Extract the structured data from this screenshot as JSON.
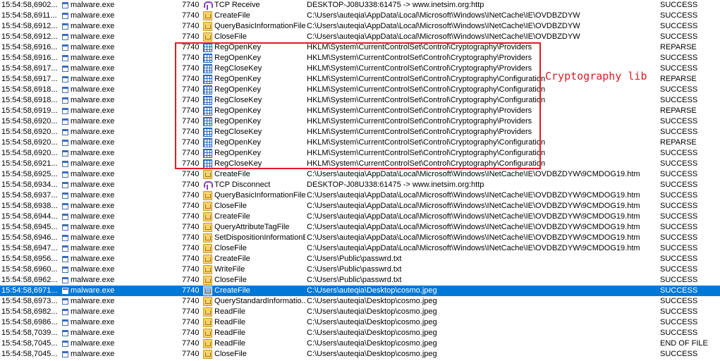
{
  "annotation": {
    "label": "Cryptography lib",
    "color": "#e01c24"
  },
  "colors": {
    "selection": "#0078d7",
    "background": "#ffffff"
  },
  "rows": [
    {
      "time": "15:54:58,6902...",
      "process": "malware.exe",
      "pid": "7740",
      "operation": "TCP Receive",
      "op_icon": "network-icon",
      "path": "DESKTOP-J08U338:61475 -> www.inetsim.org:http",
      "result": "SUCCESS"
    },
    {
      "time": "15:54:58,6911...",
      "process": "malware.exe",
      "pid": "7740",
      "operation": "CreateFile",
      "op_icon": "file-icon",
      "path": "C:\\Users\\auteqia\\AppData\\Local\\Microsoft\\Windows\\INetCache\\IE\\OVDBZDYW",
      "result": "SUCCESS"
    },
    {
      "time": "15:54:58,6912...",
      "process": "malware.exe",
      "pid": "7740",
      "operation": "QueryBasicInformationFile",
      "op_icon": "file-icon",
      "path": "C:\\Users\\auteqia\\AppData\\Local\\Microsoft\\Windows\\INetCache\\IE\\OVDBZDYW",
      "result": "SUCCESS"
    },
    {
      "time": "15:54:58,6912...",
      "process": "malware.exe",
      "pid": "7740",
      "operation": "CloseFile",
      "op_icon": "file-icon",
      "path": "C:\\Users\\auteqia\\AppData\\Local\\Microsoft\\Windows\\INetCache\\IE\\OVDBZDYW",
      "result": "SUCCESS"
    },
    {
      "time": "15:54:58,6916...",
      "process": "malware.exe",
      "pid": "7740",
      "operation": "RegOpenKey",
      "op_icon": "registry-icon",
      "path": "HKLM\\System\\CurrentControlSet\\Control\\Cryptography\\Providers",
      "result": "REPARSE"
    },
    {
      "time": "15:54:58,6916...",
      "process": "malware.exe",
      "pid": "7740",
      "operation": "RegOpenKey",
      "op_icon": "registry-icon",
      "path": "HKLM\\System\\CurrentControlSet\\Control\\Cryptography\\Providers",
      "result": "SUCCESS"
    },
    {
      "time": "15:54:58,6917...",
      "process": "malware.exe",
      "pid": "7740",
      "operation": "RegCloseKey",
      "op_icon": "registry-icon",
      "path": "HKLM\\System\\CurrentControlSet\\Control\\Cryptography\\Providers",
      "result": "SUCCESS"
    },
    {
      "time": "15:54:58,6917...",
      "process": "malware.exe",
      "pid": "7740",
      "operation": "RegOpenKey",
      "op_icon": "registry-icon",
      "path": "HKLM\\System\\CurrentControlSet\\Control\\Cryptography\\Configuration",
      "result": "REPARSE"
    },
    {
      "time": "15:54:58,6918...",
      "process": "malware.exe",
      "pid": "7740",
      "operation": "RegOpenKey",
      "op_icon": "registry-icon",
      "path": "HKLM\\System\\CurrentControlSet\\Control\\Cryptography\\Configuration",
      "result": "SUCCESS"
    },
    {
      "time": "15:54:58,6918...",
      "process": "malware.exe",
      "pid": "7740",
      "operation": "RegCloseKey",
      "op_icon": "registry-icon",
      "path": "HKLM\\System\\CurrentControlSet\\Control\\Cryptography\\Configuration",
      "result": "SUCCESS"
    },
    {
      "time": "15:54:58,6919...",
      "process": "malware.exe",
      "pid": "7740",
      "operation": "RegOpenKey",
      "op_icon": "registry-icon",
      "path": "HKLM\\System\\CurrentControlSet\\Control\\Cryptography\\Providers",
      "result": "REPARSE"
    },
    {
      "time": "15:54:58,6920...",
      "process": "malware.exe",
      "pid": "7740",
      "operation": "RegOpenKey",
      "op_icon": "registry-icon",
      "path": "HKLM\\System\\CurrentControlSet\\Control\\Cryptography\\Providers",
      "result": "SUCCESS"
    },
    {
      "time": "15:54:58,6920...",
      "process": "malware.exe",
      "pid": "7740",
      "operation": "RegCloseKey",
      "op_icon": "registry-icon",
      "path": "HKLM\\System\\CurrentControlSet\\Control\\Cryptography\\Providers",
      "result": "SUCCESS"
    },
    {
      "time": "15:54:58,6920...",
      "process": "malware.exe",
      "pid": "7740",
      "operation": "RegOpenKey",
      "op_icon": "registry-icon",
      "path": "HKLM\\System\\CurrentControlSet\\Control\\Cryptography\\Configuration",
      "result": "REPARSE"
    },
    {
      "time": "15:54:58,6920...",
      "process": "malware.exe",
      "pid": "7740",
      "operation": "RegOpenKey",
      "op_icon": "registry-icon",
      "path": "HKLM\\System\\CurrentControlSet\\Control\\Cryptography\\Configuration",
      "result": "SUCCESS"
    },
    {
      "time": "15:54:58,6921...",
      "process": "malware.exe",
      "pid": "7740",
      "operation": "RegCloseKey",
      "op_icon": "registry-icon",
      "path": "HKLM\\System\\CurrentControlSet\\Control\\Cryptography\\Configuration",
      "result": "SUCCESS"
    },
    {
      "time": "15:54:58,6925...",
      "process": "malware.exe",
      "pid": "7740",
      "operation": "CreateFile",
      "op_icon": "file-icon",
      "path": "C:\\Users\\auteqia\\AppData\\Local\\Microsoft\\Windows\\INetCache\\IE\\OVDBZDYW\\9CMDOG19.htm",
      "result": "SUCCESS"
    },
    {
      "time": "15:54:58,6934...",
      "process": "malware.exe",
      "pid": "7740",
      "operation": "TCP Disconnect",
      "op_icon": "network-icon",
      "path": "DESKTOP-J08U338:61475 -> www.inetsim.org:http",
      "result": "SUCCESS"
    },
    {
      "time": "15:54:58,6937...",
      "process": "malware.exe",
      "pid": "7740",
      "operation": "QueryBasicInformationFile",
      "op_icon": "file-icon",
      "path": "C:\\Users\\auteqia\\AppData\\Local\\Microsoft\\Windows\\INetCache\\IE\\OVDBZDYW\\9CMDOG19.htm",
      "result": "SUCCESS"
    },
    {
      "time": "15:54:58,6938...",
      "process": "malware.exe",
      "pid": "7740",
      "operation": "CloseFile",
      "op_icon": "file-icon",
      "path": "C:\\Users\\auteqia\\AppData\\Local\\Microsoft\\Windows\\INetCache\\IE\\OVDBZDYW\\9CMDOG19.htm",
      "result": "SUCCESS"
    },
    {
      "time": "15:54:58,6944...",
      "process": "malware.exe",
      "pid": "7740",
      "operation": "CreateFile",
      "op_icon": "file-icon",
      "path": "C:\\Users\\auteqia\\AppData\\Local\\Microsoft\\Windows\\INetCache\\IE\\OVDBZDYW\\9CMDOG19.htm",
      "result": "SUCCESS"
    },
    {
      "time": "15:54:58,6945...",
      "process": "malware.exe",
      "pid": "7740",
      "operation": "QueryAttributeTagFile",
      "op_icon": "file-icon",
      "path": "C:\\Users\\auteqia\\AppData\\Local\\Microsoft\\Windows\\INetCache\\IE\\OVDBZDYW\\9CMDOG19.htm",
      "result": "SUCCESS"
    },
    {
      "time": "15:54:58,6946...",
      "process": "malware.exe",
      "pid": "7740",
      "operation": "SetDispositionInformationEx",
      "op_icon": "file-icon",
      "path": "C:\\Users\\auteqia\\AppData\\Local\\Microsoft\\Windows\\INetCache\\IE\\OVDBZDYW\\9CMDOG19.htm",
      "result": "SUCCESS"
    },
    {
      "time": "15:54:58,6947...",
      "process": "malware.exe",
      "pid": "7740",
      "operation": "CloseFile",
      "op_icon": "file-icon",
      "path": "C:\\Users\\auteqia\\AppData\\Local\\Microsoft\\Windows\\INetCache\\IE\\OVDBZDYW\\9CMDOG19.htm",
      "result": "SUCCESS"
    },
    {
      "time": "15:54:58,6956...",
      "process": "malware.exe",
      "pid": "7740",
      "operation": "CreateFile",
      "op_icon": "file-icon",
      "path": "C:\\Users\\Public\\passwrd.txt",
      "result": "SUCCESS"
    },
    {
      "time": "15:54:58,6960...",
      "process": "malware.exe",
      "pid": "7740",
      "operation": "WriteFile",
      "op_icon": "file-icon",
      "path": "C:\\Users\\Public\\passwrd.txt",
      "result": "SUCCESS"
    },
    {
      "time": "15:54:58,6962...",
      "process": "malware.exe",
      "pid": "7740",
      "operation": "CloseFile",
      "op_icon": "file-icon",
      "path": "C:\\Users\\Public\\passwrd.txt",
      "result": "SUCCESS"
    },
    {
      "time": "15:54:58,6971...",
      "process": "malware.exe",
      "pid": "7740",
      "operation": "CreateFile",
      "op_icon": "file-icon",
      "path": "C:\\Users\\auteqia\\Desktop\\cosmo.jpeg",
      "result": "SUCCESS",
      "selected": true
    },
    {
      "time": "15:54:58,6973...",
      "process": "malware.exe",
      "pid": "7740",
      "operation": "QueryStandardInformatio...",
      "op_icon": "file-icon",
      "path": "C:\\Users\\auteqia\\Desktop\\cosmo.jpeg",
      "result": "SUCCESS"
    },
    {
      "time": "15:54:58,6982...",
      "process": "malware.exe",
      "pid": "7740",
      "operation": "ReadFile",
      "op_icon": "file-icon",
      "path": "C:\\Users\\auteqia\\Desktop\\cosmo.jpeg",
      "result": "SUCCESS"
    },
    {
      "time": "15:54:58,6986...",
      "process": "malware.exe",
      "pid": "7740",
      "operation": "ReadFile",
      "op_icon": "file-icon",
      "path": "C:\\Users\\auteqia\\Desktop\\cosmo.jpeg",
      "result": "SUCCESS"
    },
    {
      "time": "15:54:58,7039...",
      "process": "malware.exe",
      "pid": "7740",
      "operation": "ReadFile",
      "op_icon": "file-icon",
      "path": "C:\\Users\\auteqia\\Desktop\\cosmo.jpeg",
      "result": "SUCCESS"
    },
    {
      "time": "15:54:58,7045...",
      "process": "malware.exe",
      "pid": "7740",
      "operation": "ReadFile",
      "op_icon": "file-icon",
      "path": "C:\\Users\\auteqia\\Desktop\\cosmo.jpeg",
      "result": "END OF FILE"
    },
    {
      "time": "15:54:58,7045...",
      "process": "malware.exe",
      "pid": "7740",
      "operation": "CloseFile",
      "op_icon": "file-icon",
      "path": "C:\\Users\\auteqia\\Desktop\\cosmo.jpeg",
      "result": "SUCCESS"
    }
  ]
}
